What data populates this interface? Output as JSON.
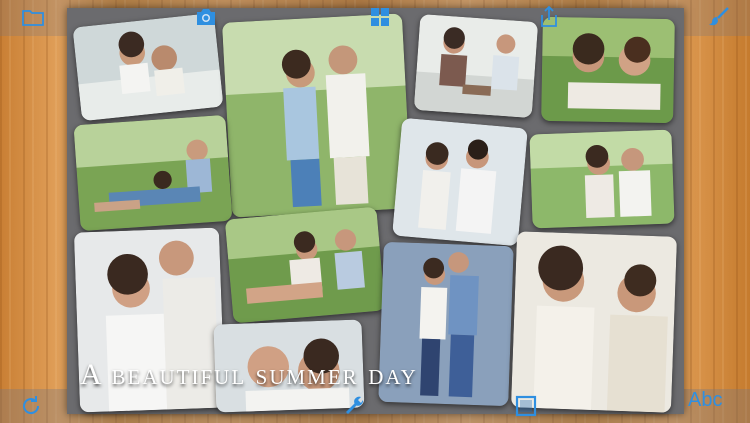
{
  "toolbar_top": {
    "items": [
      {
        "name": "folder-icon"
      },
      {
        "name": "camera-icon"
      },
      {
        "name": "layout-grid-icon"
      },
      {
        "name": "share-icon"
      },
      {
        "name": "brush-icon"
      }
    ]
  },
  "toolbar_bottom": {
    "items": [
      {
        "name": "rotate-icon"
      },
      {
        "name": "wrench-icon"
      },
      {
        "name": "frame-icon"
      }
    ],
    "text_label": "Abc"
  },
  "collage": {
    "caption": "A beautiful summer day",
    "photo_count": 13
  },
  "colors": {
    "accent": "#2f8fe0",
    "board": "#6b6b6e",
    "wood": "#d3914a"
  }
}
